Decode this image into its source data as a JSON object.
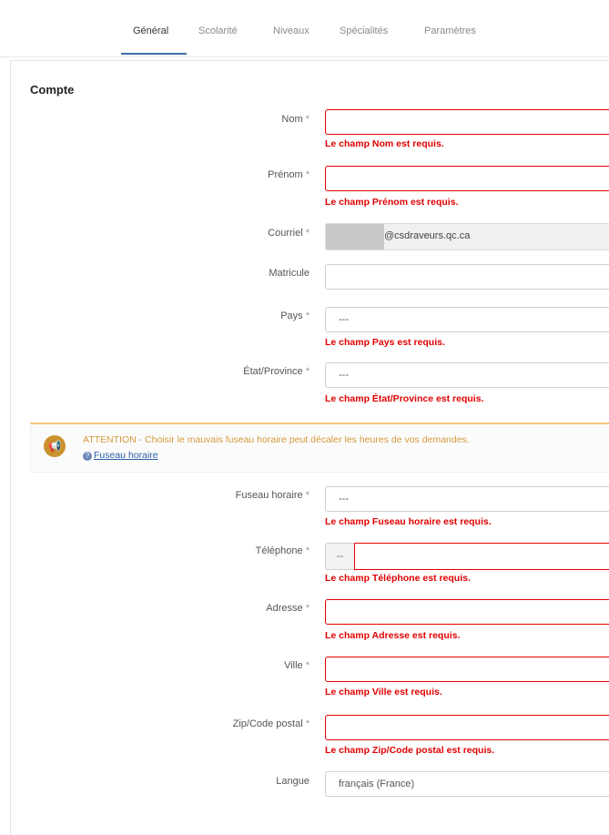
{
  "tabs": [
    {
      "label": "Général"
    },
    {
      "label": "Scolarité"
    },
    {
      "label": "Niveaux"
    },
    {
      "label": "Spécialités"
    },
    {
      "label": "Paramètres"
    }
  ],
  "section": {
    "title": "Compte"
  },
  "required_mark": "*",
  "fields": {
    "nom": {
      "label": "Nom",
      "value": "",
      "error": "Le champ Nom est requis."
    },
    "prenom": {
      "label": "Prénom",
      "value": "",
      "error": "Le champ Prénom est requis."
    },
    "courriel": {
      "label": "Courriel",
      "value": "@csdraveurs.qc.ca"
    },
    "matricule": {
      "label": "Matricule",
      "value": ""
    },
    "pays": {
      "label": "Pays",
      "value": "---",
      "error": "Le champ Pays est requis."
    },
    "etat": {
      "label": "État/Province",
      "value": "---",
      "error": "Le champ État/Province est requis."
    },
    "fuseau": {
      "label": "Fuseau horaire",
      "value": "---",
      "error": "Le champ Fuseau horaire est requis."
    },
    "telephone": {
      "label": "Téléphone",
      "prefix": "--",
      "value": "",
      "error": "Le champ Téléphone est requis."
    },
    "adresse": {
      "label": "Adresse",
      "value": "",
      "error": "Le champ Adresse est requis."
    },
    "ville": {
      "label": "Ville",
      "value": "",
      "error": "Le champ Ville est requis."
    },
    "zip": {
      "label": "Zip/Code postal",
      "value": "",
      "error": "Le champ Zip/Code postal est requis."
    },
    "langue": {
      "label": "Langue",
      "value": "français (France)"
    }
  },
  "alert": {
    "icon": "megaphone-icon",
    "text": "ATTENTION - Choisir le mauvais fuseau horaire peut décaler les heures de vos demandes.",
    "link": "Fuseau horaire"
  },
  "colors": {
    "error": "#e00000",
    "accent": "#3b6ea8",
    "warning": "#d49a3d"
  }
}
